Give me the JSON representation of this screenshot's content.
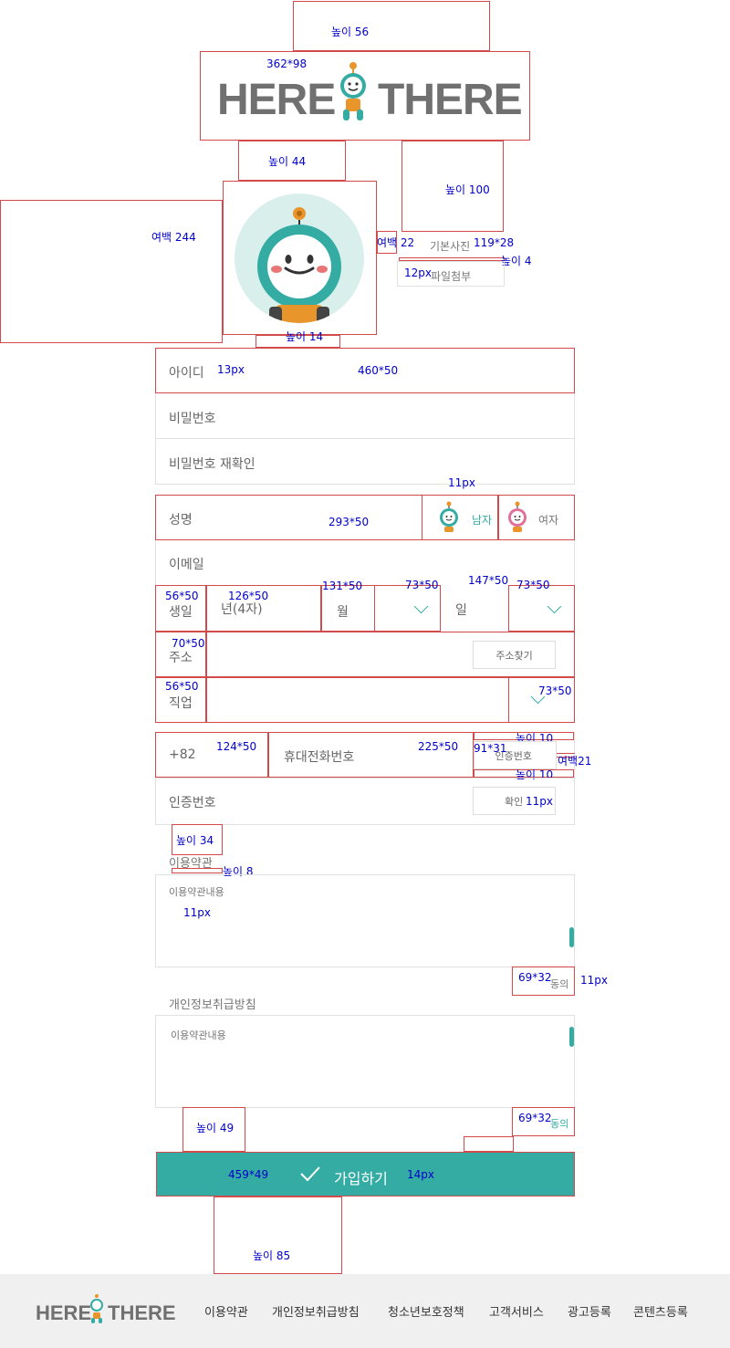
{
  "annotations": {
    "top_height": "높이 56",
    "logo_size": "362*98",
    "gap_44": "높이 44",
    "gap_100": "높이 100",
    "margin_244": "여백 244",
    "margin_22": "여백 22",
    "default_photo_size": "119*28",
    "gap_4": "높이 4",
    "font_12": "12px",
    "gap_14": "높이 14",
    "font_13": "13px",
    "field_460": "460*50",
    "font_11_a": "11px",
    "name_293": "293*50",
    "s56_a": "56*50",
    "s126": "126*50",
    "s131": "131*50",
    "s73_a": "73*50",
    "s147": "147*50",
    "s73_b": "73*50",
    "s70": "70*50",
    "s56_b": "56*50",
    "s73_c": "73*50",
    "s124": "124*50",
    "s225": "225*50",
    "gap10_a": "높이 10",
    "s91": "91*31",
    "margin21": "여백21",
    "gap10_b": "높이 10",
    "font_11_b": "11px",
    "gap_34": "높이 34",
    "gap_8": "높이 8",
    "font_11_c": "11px",
    "s69_a": "69*32",
    "font_11_d": "11px",
    "gap_49": "높이 49",
    "s69_b": "69*32",
    "s459": "459*49",
    "font_14": "14px",
    "gap_85": "높이 85"
  },
  "logo": {
    "left": "HERE",
    "right": "THERE"
  },
  "photo": {
    "default_label": "기본사진",
    "attach_label": "파일첨부"
  },
  "form": {
    "id": "아이디",
    "password": "비밀번호",
    "password_confirm": "비밀번호 재확인",
    "name": "성명",
    "male": "남자",
    "female": "여자",
    "email": "이메일",
    "birth": "생일",
    "year": "년(4자)",
    "month": "월",
    "day": "일",
    "address": "주소",
    "address_search": "주소찾기",
    "job": "직업",
    "country_code": "+82",
    "phone": "휴대전화번호",
    "verify_request": "인증번호",
    "verify_code": "인증번호",
    "confirm": "확인"
  },
  "terms": {
    "title": "이용약관",
    "content": "이용약관내용",
    "agree": "동의"
  },
  "privacy": {
    "title": "개인정보취급방침",
    "content": "이용약관내용",
    "agree": "동의"
  },
  "submit": {
    "label": "가입하기"
  },
  "footer": {
    "links": [
      "이용약관",
      "개인정보취급방침",
      "청소년보호정책",
      "고객서비스",
      "광고등록",
      "콘텐츠등록"
    ]
  },
  "colors": {
    "accent": "#34aca3",
    "annotation": "#0000cc",
    "guide": "#d24a4a"
  }
}
